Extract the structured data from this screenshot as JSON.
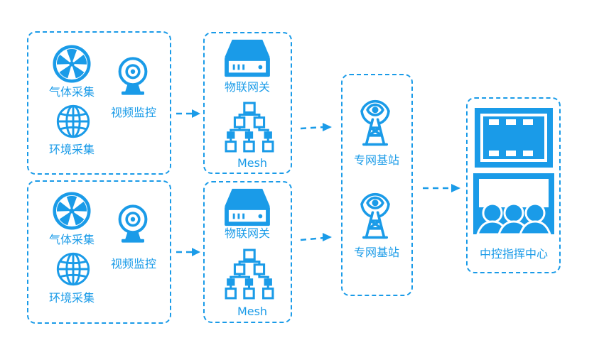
{
  "colors": {
    "primary": "#1a9be8",
    "background": "#ffffff"
  },
  "groups": [
    {
      "sensors": {
        "gas": "气体采集",
        "env": "环境采集",
        "video": "视频监控"
      },
      "gateway": {
        "iot": "物联网关",
        "mesh": "Mesh"
      }
    },
    {
      "sensors": {
        "gas": "气体采集",
        "env": "环境采集",
        "video": "视频监控"
      },
      "gateway": {
        "iot": "物联网关",
        "mesh": "Mesh"
      }
    }
  ],
  "base_stations": [
    "专网基站",
    "专网基站"
  ],
  "command_center": "中控指挥中心",
  "icons": [
    "fan-icon",
    "globe-icon",
    "webcam-icon",
    "server-icon",
    "network-tree-icon",
    "antenna-tower-icon",
    "command-center-icon"
  ]
}
